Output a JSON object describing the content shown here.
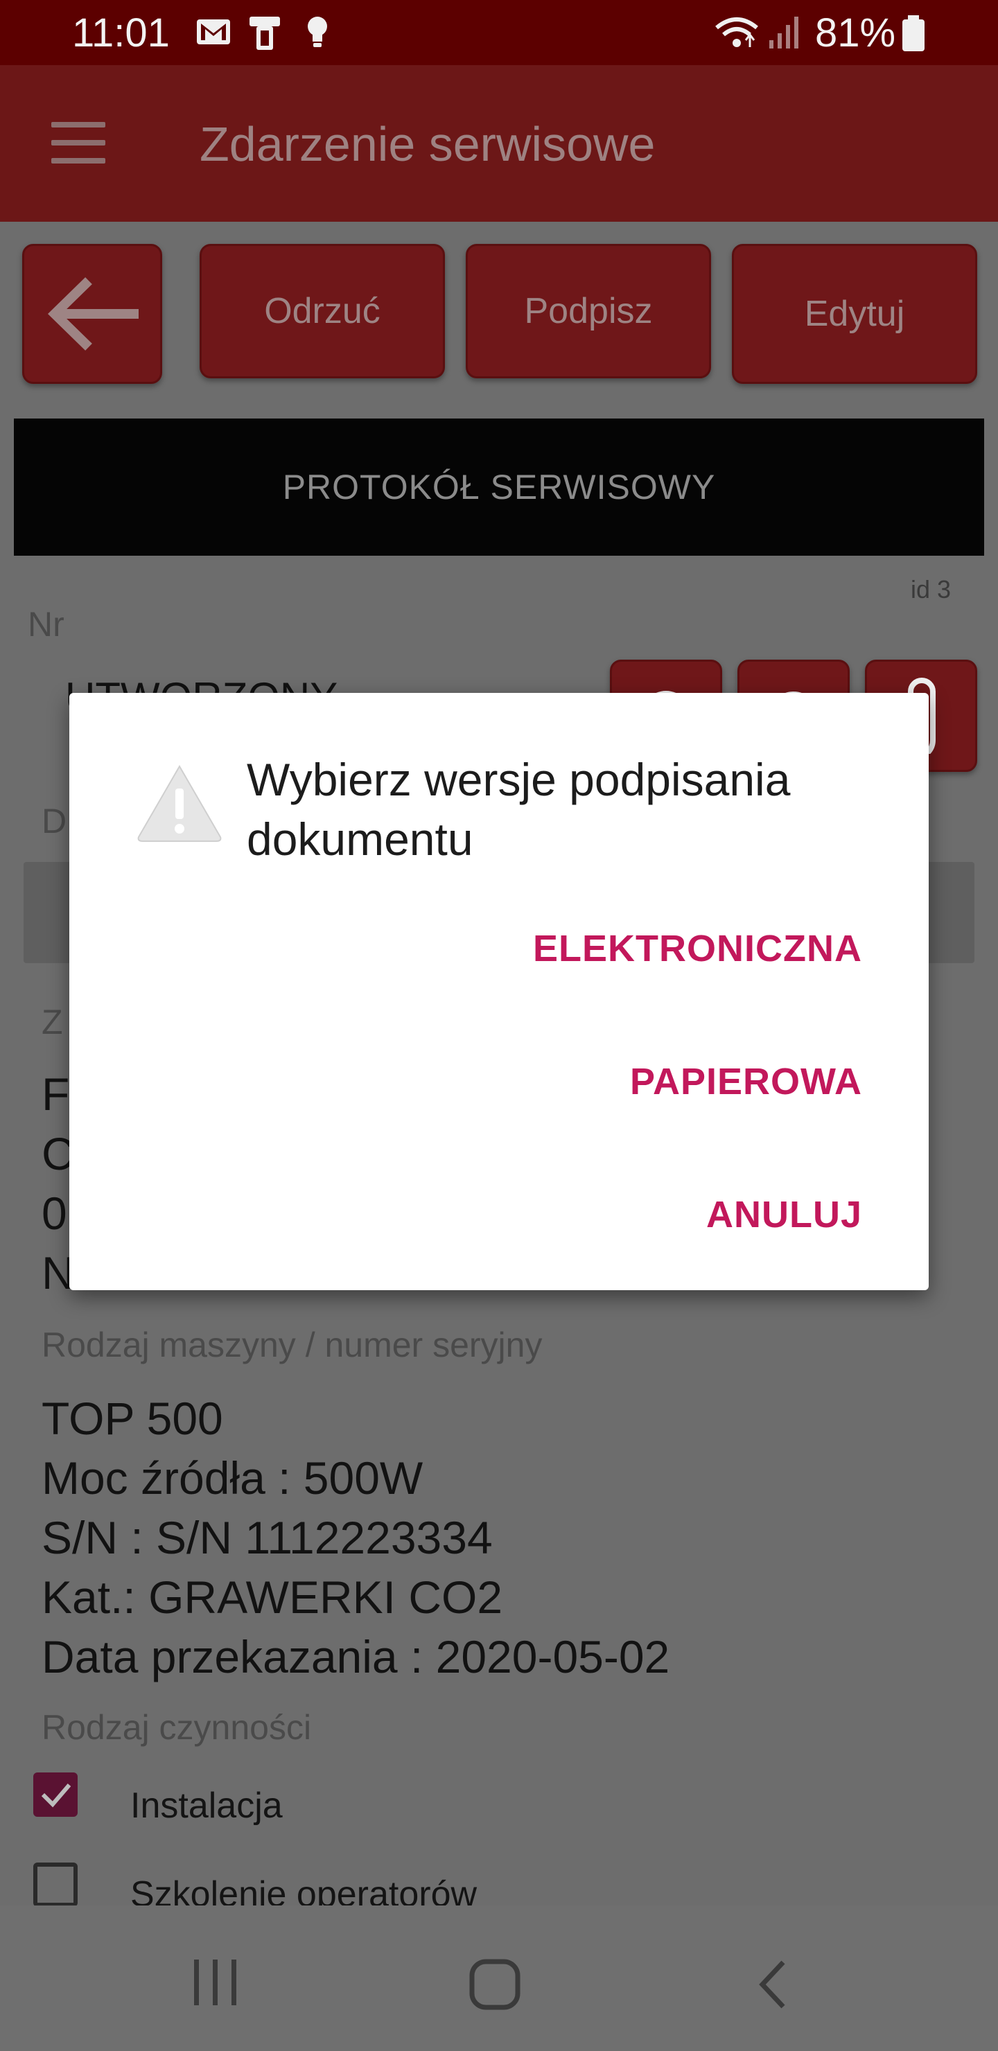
{
  "status_bar": {
    "time": "11:01",
    "battery": "81%",
    "icons": [
      "gmail-icon",
      "device-icon",
      "bulb-icon",
      "wifi-icon",
      "signal-icon",
      "battery-icon"
    ]
  },
  "app_bar": {
    "title": "Zdarzenie serwisowe",
    "menu_icon": "hamburger-icon"
  },
  "toolbar": {
    "back_icon": "arrow-left-icon",
    "reject_label": "Odrzuć",
    "sign_label": "Podpisz",
    "edit_label": "Edytuj"
  },
  "document": {
    "header": "PROTOKÓŁ SERWISOWY",
    "id_label": "id 3",
    "nr_label": "Nr",
    "status_partial": "UTWORZONY",
    "partial_label_d": "D",
    "partial_label_z": "Z",
    "partial_lines": [
      "F",
      "C",
      "0",
      "N"
    ],
    "machine_label": "Rodzaj maszyny / numer seryjny",
    "machine_lines": [
      "TOP 500",
      "Moc źródła : 500W",
      "S/N : S/N 1112223334",
      "Kat.: GRAWERKI CO2",
      "Data przekazania : 2020-05-02"
    ],
    "activity_label": "Rodzaj czynności",
    "activities": [
      {
        "label": "Instalacja",
        "checked": true
      },
      {
        "label": "Szkolenie operatorów",
        "checked": false
      }
    ]
  },
  "dialog": {
    "icon": "warning-icon",
    "title": "Wybierz wersje podpisania dokumentu",
    "actions": [
      "ELEKTRONICZNA",
      "PAPIEROWA",
      "ANULUJ"
    ],
    "accent": "#c2185b"
  },
  "nav_bar": {
    "icons": [
      "recent-apps-icon",
      "home-icon",
      "back-icon"
    ]
  }
}
